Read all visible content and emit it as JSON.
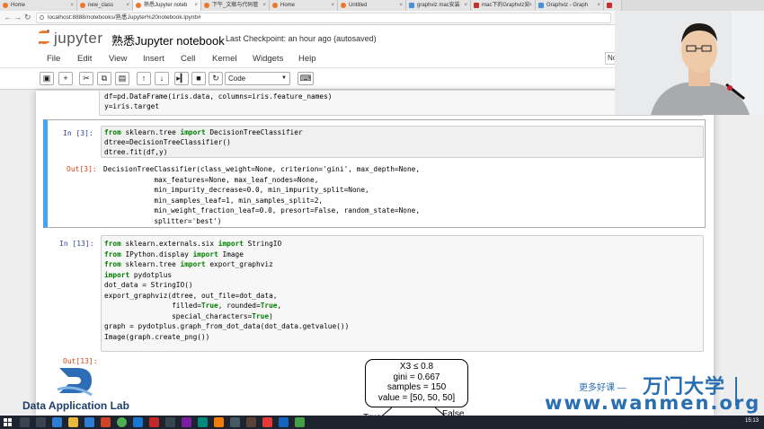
{
  "browser": {
    "tabs": [
      {
        "label": "Home",
        "icon": "jupyter-favicon-icon"
      },
      {
        "label": "new_class",
        "icon": "jupyter-favicon-icon"
      },
      {
        "label": "熟悉Jupyter noteb",
        "icon": "jupyter-favicon-icon",
        "active": true
      },
      {
        "label": "下午_文献与代码管",
        "icon": "jupyter-favicon-icon"
      },
      {
        "label": "Home",
        "icon": "jupyter-favicon-icon"
      },
      {
        "label": "Untitled",
        "icon": "jupyter-favicon-icon"
      },
      {
        "label": "graphviz mac安装",
        "icon": "page-favicon-icon"
      },
      {
        "label": "mac下的Graphviz安",
        "icon": "csdn-favicon-icon"
      },
      {
        "label": "Graphviz - Graph",
        "icon": "page-favicon-icon"
      },
      {
        "label": "",
        "icon": "csdn-favicon-icon"
      }
    ],
    "url": "localhost:8888/notebooks/熟悉Jupyter%20notebook.ipynb#"
  },
  "header": {
    "logo_text": "jupyter",
    "notebook_title": "熟悉Jupyter notebook",
    "checkpoint": "Last Checkpoint: an hour ago (autosaved)",
    "kernel_indicator": "No"
  },
  "menu": [
    "File",
    "Edit",
    "View",
    "Insert",
    "Cell",
    "Kernel",
    "Widgets",
    "Help"
  ],
  "toolbar": {
    "cell_type": "Code",
    "buttons": [
      "save-icon",
      "add-cell-icon",
      "cut-icon",
      "copy-icon",
      "paste-icon",
      "move-up-icon",
      "move-down-icon",
      "run-icon",
      "stop-icon",
      "restart-icon",
      "command-palette-icon"
    ]
  },
  "cells": {
    "prev": {
      "lines": [
        "df=pd.DataFrame(iris.data, columns=iris.feature_names)",
        "y=iris.target"
      ]
    },
    "c3": {
      "prompt": "In  [3]:",
      "lines": [
        "from sklearn.tree import DecisionTreeClassifier",
        "dtree=DecisionTreeClassifier()",
        "dtree.fit(df,y)"
      ],
      "out_prompt": "Out[3]:",
      "output": [
        "DecisionTreeClassifier(class_weight=None, criterion='gini', max_depth=None,",
        "            max_features=None, max_leaf_nodes=None,",
        "            min_impurity_decrease=0.0, min_impurity_split=None,",
        "            min_samples_leaf=1, min_samples_split=2,",
        "            min_weight_fraction_leaf=0.0, presort=False, random_state=None,",
        "            splitter='best')"
      ]
    },
    "c13": {
      "prompt": "In  [13]:",
      "lines": [
        "from sklearn.externals.six import StringIO",
        "from IPython.display import Image",
        "from sklearn.tree import export_graphviz",
        "import pydotplus",
        "dot_data = StringIO()",
        "export_graphviz(dtree, out_file=dot_data,",
        "                filled=True, rounded=True,",
        "                special_characters=True)",
        "graph = pydotplus.graph_from_dot_data(dot_data.getvalue())",
        "Image(graph.create_png())"
      ],
      "out_prompt": "Out[13]:"
    }
  },
  "tree": {
    "root": [
      "X3 ≤ 0.8",
      "gini = 0.667",
      "samples = 150",
      "value = [50, 50, 50]"
    ],
    "left_edge": "True",
    "right_edge": "False"
  },
  "watermark": {
    "lab_name": "Data Application Lab",
    "cn_small": "更多好课 —",
    "cn_big": "万门大学",
    "url": "www.wanmen.org"
  },
  "taskbar": {
    "clock": "15:13"
  },
  "colors": {
    "jupyter_orange": "#f37626",
    "selected_cell_bar": "#42a5f5",
    "in_prompt": "#303f9f",
    "out_prompt": "#d84315",
    "keyword": "#008000",
    "string": "#ba2121",
    "watermark_blue": "#2b6fb3"
  }
}
